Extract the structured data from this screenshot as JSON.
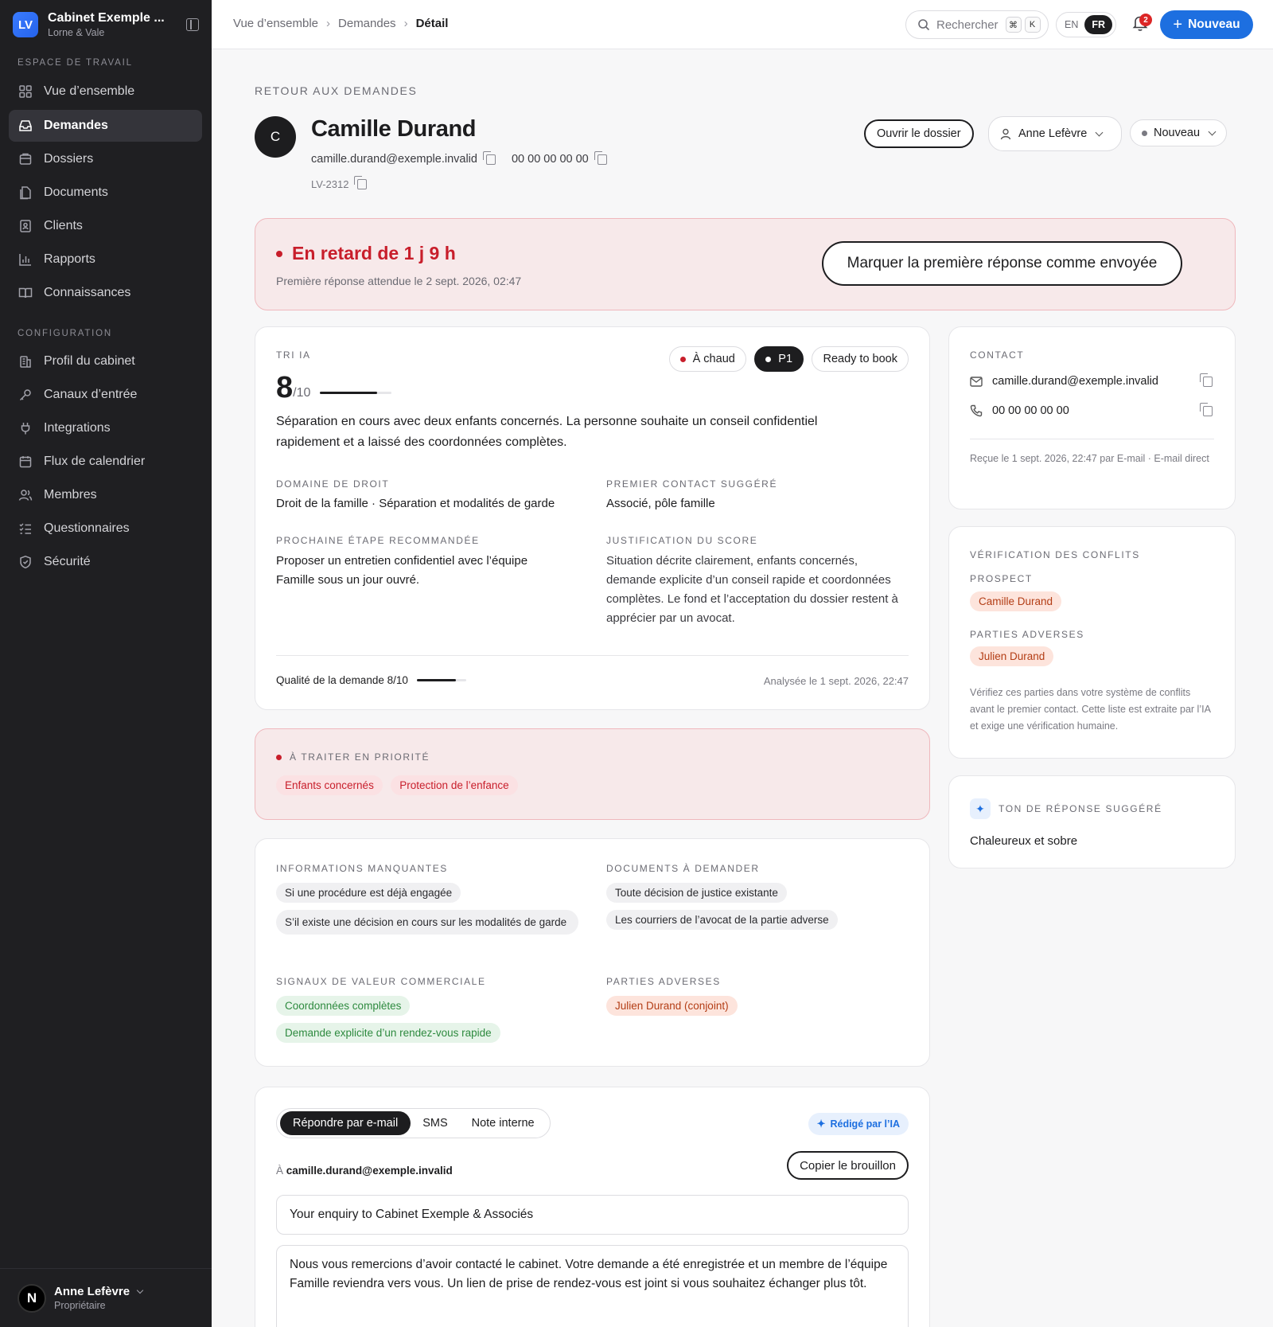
{
  "sidebar": {
    "brand": {
      "logo": "LV",
      "name": "Cabinet Exemple ...",
      "subtitle": "Lorne & Vale"
    },
    "workspace_label": "ESPACE DE TRAVAIL",
    "workspace_items": [
      {
        "label": "Vue d’ensemble",
        "icon": "grid-icon"
      },
      {
        "label": "Demandes",
        "icon": "inbox-icon",
        "active": true
      },
      {
        "label": "Dossiers",
        "icon": "folder-icon"
      },
      {
        "label": "Documents",
        "icon": "document-icon"
      },
      {
        "label": "Clients",
        "icon": "contact-icon"
      },
      {
        "label": "Rapports",
        "icon": "chart-icon"
      },
      {
        "label": "Connaissances",
        "icon": "book-icon"
      }
    ],
    "config_label": "CONFIGURATION",
    "config_items": [
      {
        "label": "Profil du cabinet",
        "icon": "building-icon"
      },
      {
        "label": "Canaux d’entrée",
        "icon": "key-icon"
      },
      {
        "label": "Integrations",
        "icon": "plug-icon"
      },
      {
        "label": "Flux de calendrier",
        "icon": "calendar-icon"
      },
      {
        "label": "Membres",
        "icon": "users-icon"
      },
      {
        "label": "Questionnaires",
        "icon": "checklist-icon"
      },
      {
        "label": "Sécurité",
        "icon": "shield-icon"
      }
    ],
    "user": {
      "initial": "N",
      "name": "Anne Lefèvre",
      "role": "Propriétaire"
    }
  },
  "topbar": {
    "breadcrumbs": [
      "Vue d’ensemble",
      "Demandes",
      "Détail"
    ],
    "search_placeholder": "Rechercher",
    "search_keys": [
      "⌘",
      "K"
    ],
    "lang_en": "EN",
    "lang_fr": "FR",
    "notif_count": "2",
    "new_label": "Nouveau"
  },
  "header": {
    "back": "RETOUR AUX DEMANDES",
    "avatar": "C",
    "name": "Camille Durand",
    "email": "camille.durand@exemple.invalid",
    "phone": "00 00 00 00 00",
    "ref": "LV-2312",
    "open_file": "Ouvrir le dossier",
    "assignee": "Anne Lefèvre",
    "status": "Nouveau"
  },
  "alert": {
    "title": "En retard de 1 j 9 h",
    "subtitle": "Première réponse attendue le 2 sept. 2026, 02:47",
    "button": "Marquer la première réponse comme envoyée"
  },
  "triage": {
    "label": "TRI IA",
    "score": "8",
    "score_max": "/10",
    "score_fraction": 0.8,
    "tags": [
      "À chaud",
      "P1",
      "Ready to book"
    ],
    "summary": "Séparation en cours avec deux enfants concernés. La personne souhaite un conseil confidentiel rapidement et a laissé des coordonnées complètes.",
    "domain_label": "DOMAINE DE DROIT",
    "domain": "Droit de la famille · Séparation et modalités de garde",
    "contact_label": "PREMIER CONTACT SUGGÉRÉ",
    "contact": "Associé, pôle famille",
    "next_label": "PROCHAINE ÉTAPE RECOMMANDÉE",
    "next": "Proposer un entretien confidentiel avec l’équipe Famille sous un jour ouvré.",
    "justif_label": "JUSTIFICATION DU SCORE",
    "justif": "Situation décrite clairement, enfants concernés, demande explicite d’un conseil rapide et coordonnées complètes. Le fond et l’acceptation du dossier restent à apprécier par un avocat.",
    "quality": "Qualité de la demande 8/10",
    "quality_fraction": 0.8,
    "analysed": "Analysée le 1 sept. 2026, 22:47"
  },
  "priority": {
    "label": "À TRAITER EN PRIORITÉ",
    "chips": [
      "Enfants concernés",
      "Protection de l’enfance"
    ]
  },
  "details": {
    "missing_label": "INFORMATIONS MANQUANTES",
    "missing": [
      "Si une procédure est déjà engagée",
      "S’il existe une décision en cours sur les modalités de garde"
    ],
    "docs_label": "DOCUMENTS À DEMANDER",
    "docs": [
      "Toute décision de justice existante",
      "Les courriers de l’avocat de la partie adverse"
    ],
    "signals_label": "SIGNAUX DE VALEUR COMMERCIALE",
    "signals": [
      "Coordonnées complètes",
      "Demande explicite d’un rendez-vous rapide"
    ],
    "adverse_label": "PARTIES ADVERSES",
    "adverse": [
      "Julien Durand (conjoint)"
    ]
  },
  "reply": {
    "tabs": [
      "Répondre par e-mail",
      "SMS",
      "Note interne"
    ],
    "ai_badge": "Rédigé par l’IA",
    "to_prefix": "À",
    "to": "camille.durand@exemple.invalid",
    "copy_draft": "Copier le brouillon",
    "subject": "Your enquiry to Cabinet Exemple & Associés",
    "body": "Nous vous remercions d’avoir contacté le cabinet. Votre demande a été enregistrée et un membre de l’équipe Famille reviendra vers vous. Un lien de prise de rendez-vous est joint si vous souhaitez échanger plus tôt."
  },
  "contact_card": {
    "label": "CONTACT",
    "email": "camille.durand@exemple.invalid",
    "phone": "00 00 00 00 00",
    "received": "Reçue le 1 sept. 2026, 22:47 par E-mail · E-mail direct"
  },
  "conflicts": {
    "label": "VÉRIFICATION DES CONFLITS",
    "prospect_label": "PROSPECT",
    "prospect": "Camille Durand",
    "adverse_label": "PARTIES ADVERSES",
    "adverse": "Julien Durand",
    "note": "Vérifiez ces parties dans votre système de conflits avant le premier contact. Cette liste est extraite par l’IA et exige une vérification humaine."
  },
  "tone": {
    "label": "TON DE RÉPONSE SUGGÉRÉ",
    "value": "Chaleureux et sobre"
  }
}
